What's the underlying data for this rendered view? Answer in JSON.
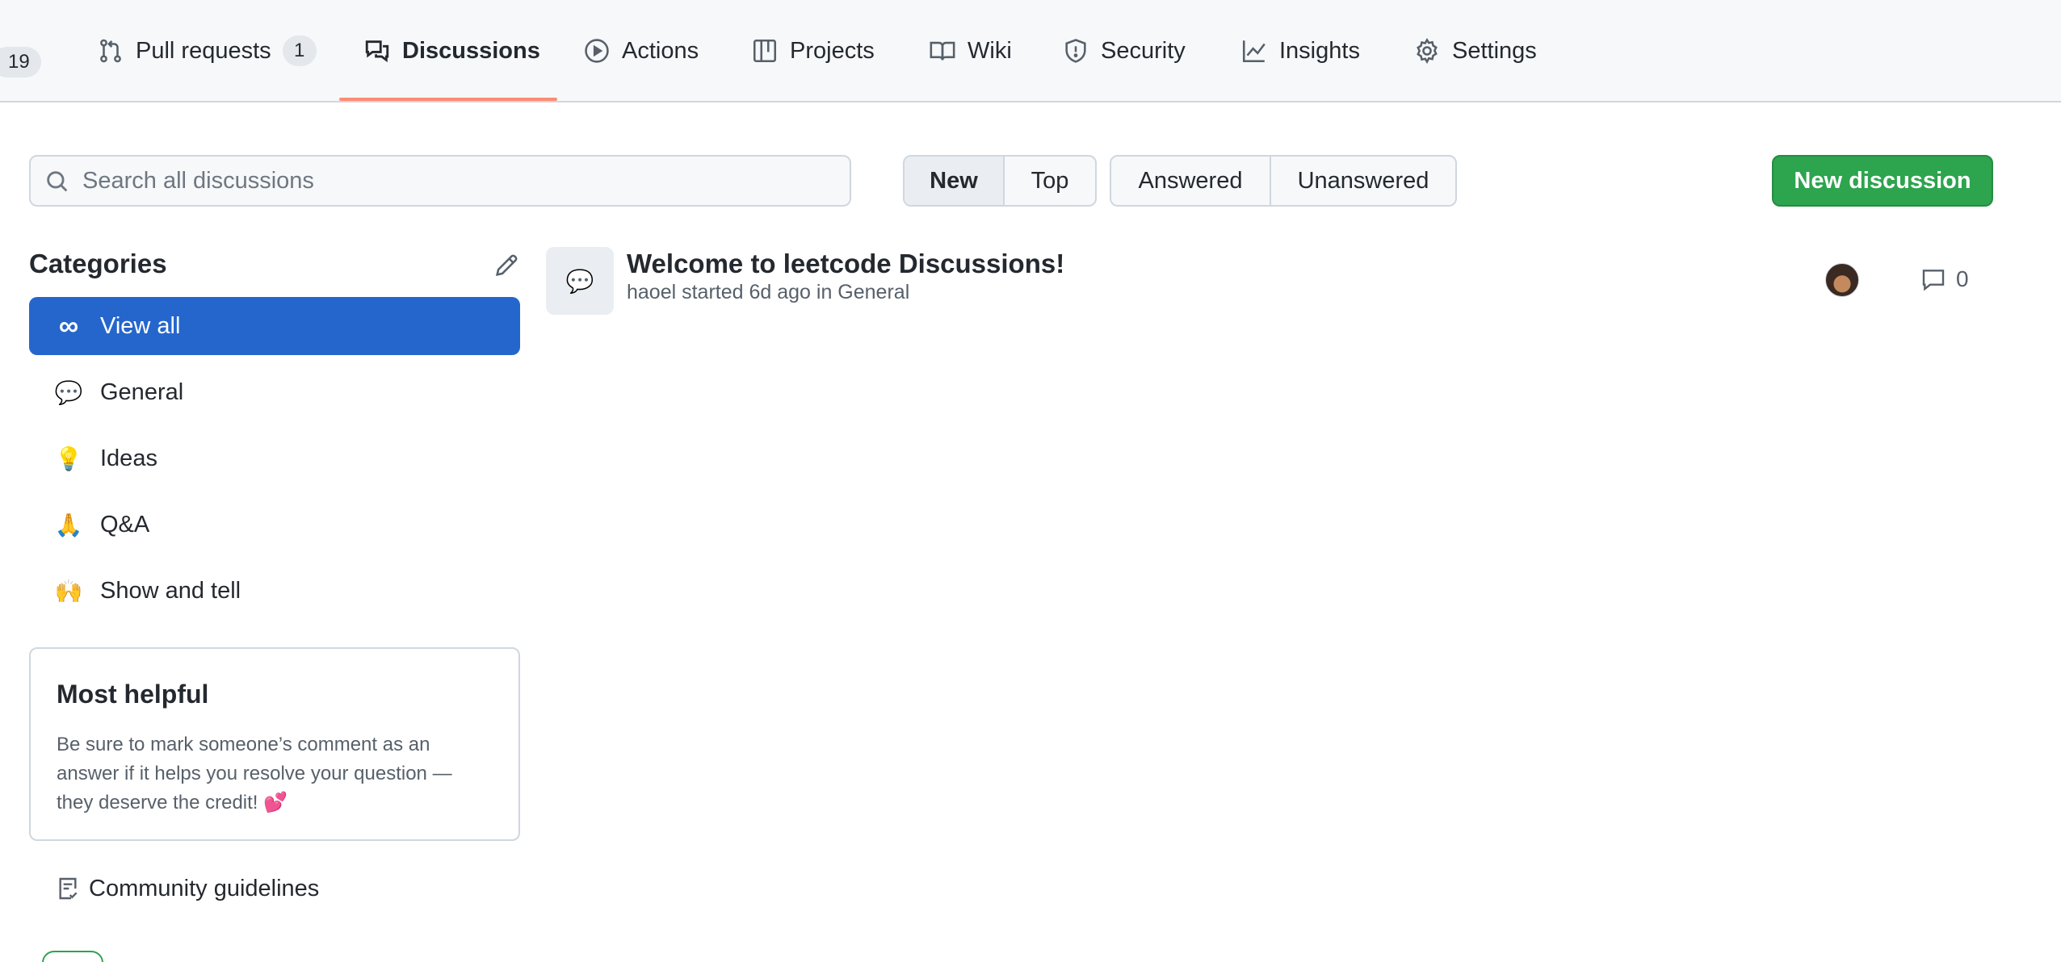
{
  "nav": {
    "issues_count": "19",
    "tabs": [
      {
        "label": "Pull requests",
        "counter": "1",
        "icon": "git-pull-request-icon"
      },
      {
        "label": "Discussions",
        "icon": "comment-discussion-icon",
        "selected": true
      },
      {
        "label": "Actions",
        "icon": "play-icon"
      },
      {
        "label": "Projects",
        "icon": "table-icon"
      },
      {
        "label": "Wiki",
        "icon": "book-icon"
      },
      {
        "label": "Security",
        "icon": "shield-icon"
      },
      {
        "label": "Insights",
        "icon": "graph-icon"
      },
      {
        "label": "Settings",
        "icon": "gear-icon"
      }
    ]
  },
  "toolbar": {
    "search_placeholder": "Search all discussions",
    "sort": {
      "new": "New",
      "top": "Top",
      "active": "New"
    },
    "filter": {
      "answered": "Answered",
      "unanswered": "Unanswered"
    },
    "new_discussion": "New discussion"
  },
  "sidebar": {
    "title": "Categories",
    "items": [
      {
        "label": "View all",
        "emoji": "∞",
        "active": true
      },
      {
        "label": "General",
        "emoji": "💬"
      },
      {
        "label": "Ideas",
        "emoji": "💡"
      },
      {
        "label": "Q&A",
        "emoji": "🙏"
      },
      {
        "label": "Show and tell",
        "emoji": "🙌"
      }
    ],
    "helpful": {
      "title": "Most helpful",
      "body": "Be sure to mark someone’s comment as an answer if it helps you resolve your question — they deserve the credit! 💕"
    },
    "guidelines": "Community guidelines"
  },
  "discussions": [
    {
      "title": "Welcome to leetcode Discussions!",
      "meta": "haoel started 6d ago in General",
      "category_emoji": "💬",
      "comments": "0"
    }
  ],
  "colors": {
    "accent_underline": "#fd8c73",
    "active_category": "#2566cc",
    "primary_button": "#2da44e"
  }
}
